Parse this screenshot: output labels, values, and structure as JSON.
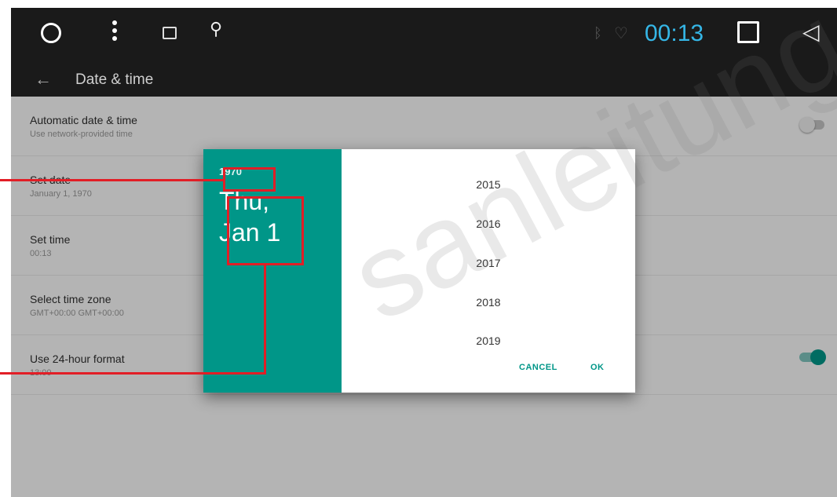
{
  "status_bar": {
    "time": "00:13",
    "time_color": "#35b6e6",
    "icons": [
      "circle-home-icon",
      "overflow-menu-icon",
      "gallery-icon",
      "usb-icon",
      "bluetooth-icon",
      "wifi-icon",
      "recents-square-icon",
      "back-triangle-icon"
    ]
  },
  "action_bar": {
    "title": "Date & time",
    "back_icon": "back-arrow-icon"
  },
  "settings": [
    {
      "title": "Automatic date & time",
      "subtitle": "Use network-provided time",
      "toggle": "off"
    },
    {
      "title": "Set date",
      "subtitle": "January 1, 1970"
    },
    {
      "title": "Set time",
      "subtitle": "00:13"
    },
    {
      "title": "Select time zone",
      "subtitle": "GMT+00:00 GMT+00:00"
    },
    {
      "title": "Use 24-hour format",
      "subtitle": "13:00",
      "toggle": "on"
    }
  ],
  "date_picker": {
    "header_year": "1970",
    "header_date_line1": "Thu,",
    "header_date_line2": "Jan 1",
    "years": [
      "2015",
      "2016",
      "2017",
      "2018",
      "2019"
    ],
    "cancel_label": "CANCEL",
    "ok_label": "OK",
    "accent_color": "#009688"
  },
  "annotation_color": "#e21e26",
  "watermark": "sanleitung"
}
